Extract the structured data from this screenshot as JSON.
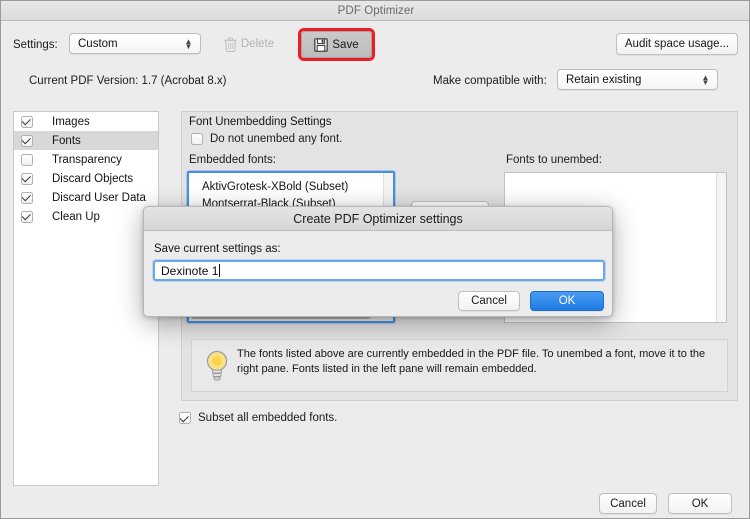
{
  "window": {
    "title": "PDF Optimizer"
  },
  "toolbar": {
    "settings_label": "Settings:",
    "settings_value": "Custom",
    "delete_label": "Delete",
    "save_label": "Save",
    "audit_label": "Audit space usage...",
    "version_text": "Current PDF Version: 1.7 (Acrobat 8.x)",
    "compat_label": "Make compatible with:",
    "compat_value": "Retain existing"
  },
  "sidebar": {
    "items": [
      {
        "label": "Images",
        "checked": true,
        "selected": false
      },
      {
        "label": "Fonts",
        "checked": true,
        "selected": true
      },
      {
        "label": "Transparency",
        "checked": false,
        "selected": false
      },
      {
        "label": "Discard Objects",
        "checked": true,
        "selected": false
      },
      {
        "label": "Discard User Data",
        "checked": true,
        "selected": false
      },
      {
        "label": "Clean Up",
        "checked": true,
        "selected": false
      }
    ]
  },
  "main": {
    "group_title": "Font Unembedding Settings",
    "do_not_unembed_label": "Do not unembed any font.",
    "do_not_unembed_checked": false,
    "embedded_label": "Embedded fonts:",
    "embedded_fonts": [
      "AktivGrotesk-XBold (Subset)",
      "Montserrat-Black (Subset)"
    ],
    "unembed_label": "Fonts to unembed:",
    "unembed_fonts": [],
    "tip_text": "The fonts listed above are currently embedded in the PDF file. To unembed a font, move it to the right pane. Fonts listed in the left pane will remain embedded.",
    "subset_label": "Subset all embedded fonts.",
    "subset_checked": true
  },
  "footer": {
    "cancel_label": "Cancel",
    "ok_label": "OK"
  },
  "modal": {
    "title": "Create PDF Optimizer settings",
    "prompt": "Save current settings as:",
    "input_value": "Dexinote 1",
    "cancel_label": "Cancel",
    "ok_label": "OK"
  },
  "colors": {
    "accent_blue": "#1e7ce4",
    "annotation_red": "#ee1c25",
    "window_bg": "#ececec",
    "group_bg": "#e3e3e3"
  }
}
